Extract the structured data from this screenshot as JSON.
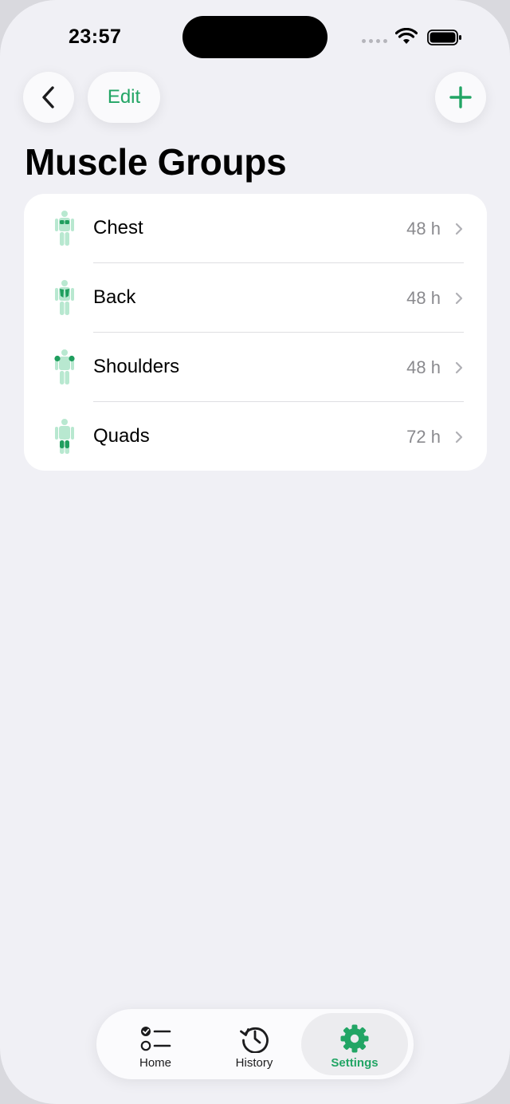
{
  "status_bar": {
    "time": "23:57"
  },
  "nav": {
    "back_icon": "chevron-left-icon",
    "edit_label": "Edit",
    "add_icon": "plus-icon"
  },
  "page": {
    "title": "Muscle Groups"
  },
  "muscle_groups": [
    {
      "name": "Chest",
      "recovery": "48 h",
      "icon": "body-chest-icon"
    },
    {
      "name": "Back",
      "recovery": "48 h",
      "icon": "body-back-icon"
    },
    {
      "name": "Shoulders",
      "recovery": "48 h",
      "icon": "body-shoulders-icon"
    },
    {
      "name": "Quads",
      "recovery": "72 h",
      "icon": "body-quads-icon"
    }
  ],
  "tab_bar": {
    "tabs": [
      {
        "label": "Home",
        "icon": "checklist-icon",
        "selected": false
      },
      {
        "label": "History",
        "icon": "history-icon",
        "selected": false
      },
      {
        "label": "Settings",
        "icon": "gear-icon",
        "selected": true
      }
    ]
  },
  "colors": {
    "accent": "#22a565",
    "background": "#f0f0f5",
    "card": "#ffffff",
    "secondary_text": "#8a8a8e",
    "body_light": "#b8e8d0",
    "body_highlight": "#1f9e5e"
  }
}
